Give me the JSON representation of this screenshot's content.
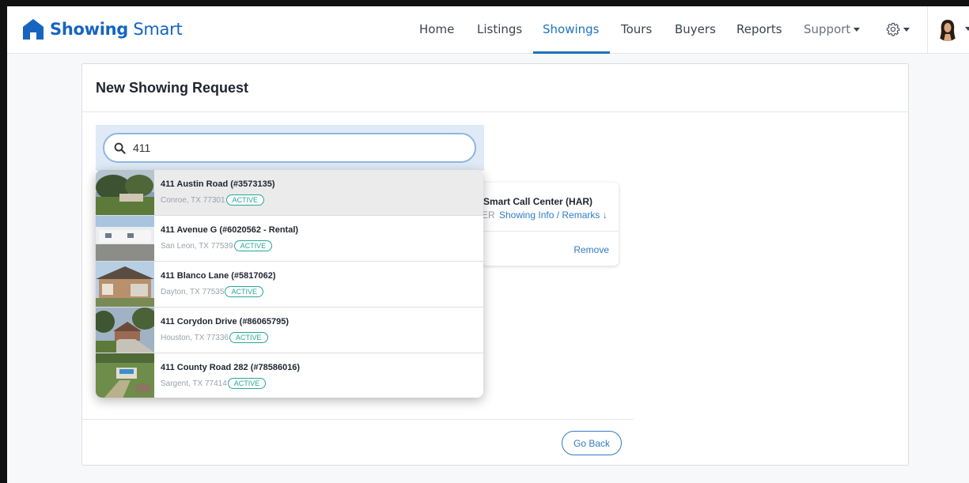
{
  "brand": {
    "name_bold": "Showing",
    "name_light": " Smart"
  },
  "nav": {
    "items": [
      "Home",
      "Listings",
      "Showings",
      "Tours",
      "Buyers",
      "Reports",
      "Support"
    ],
    "active": "Showings"
  },
  "page": {
    "title": "New Showing Request"
  },
  "search": {
    "value": "411",
    "placeholder": ""
  },
  "results": [
    {
      "title": "411 Austin Road (#3573135)",
      "address": "Conroe, TX 77301",
      "status": "ACTIVE"
    },
    {
      "title": "411 Avenue G (#6020562 - Rental)",
      "address": "San Leon, TX 77539",
      "status": "ACTIVE"
    },
    {
      "title": "411 Blanco Lane (#5817062)",
      "address": "Dayton, TX 77535",
      "status": "ACTIVE"
    },
    {
      "title": "411 Corydon Drive (#86065795)",
      "address": "Houston, TX 77336",
      "status": "ACTIVE"
    },
    {
      "title": "411 County Road 282 (#78586016)",
      "address": "Sargent, TX 77414",
      "status": "ACTIVE"
    }
  ],
  "agent_card": {
    "name": "Smart Call Center (HAR)",
    "role": "ER",
    "link": "Showing Info / Remarks ↓",
    "remove": "Remove"
  },
  "actions": {
    "go_back": "Go Back"
  },
  "colors": {
    "accent": "#1e73be",
    "badge": "#26a69a",
    "brand": "#1565c0"
  }
}
